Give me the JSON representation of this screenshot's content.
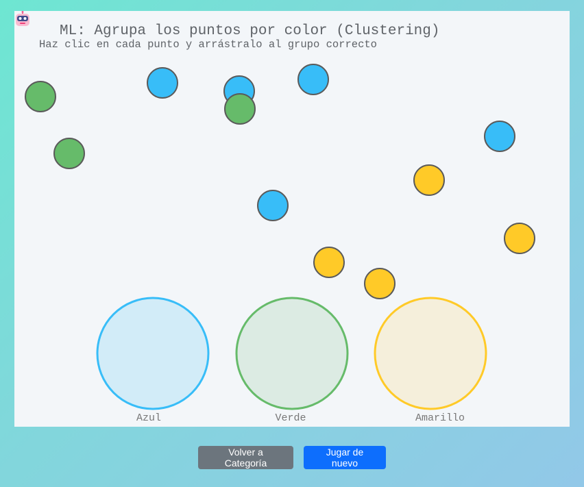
{
  "game": {
    "title": "ML: Agrupa los puntos por color (Clustering)",
    "subtitle": "Haz clic en cada punto y arrástralo al grupo correcto",
    "title_icon": "robot-icon"
  },
  "colors": {
    "blue": "#38bdf8",
    "green": "#66bb6a",
    "yellow": "#ffca28"
  },
  "groups": [
    {
      "id": "blue",
      "label": "Azul",
      "fill": "#d2ecf8",
      "stroke": "#38bdf8"
    },
    {
      "id": "green",
      "label": "Verde",
      "fill": "#dcebe3",
      "stroke": "#66bb6a"
    },
    {
      "id": "yellow",
      "label": "Amarillo",
      "fill": "#f5efdb",
      "stroke": "#ffca28"
    }
  ],
  "points": [
    {
      "color": "green"
    },
    {
      "color": "blue"
    },
    {
      "color": "blue"
    },
    {
      "color": "green"
    },
    {
      "color": "blue"
    },
    {
      "color": "green"
    },
    {
      "color": "blue"
    },
    {
      "color": "yellow"
    },
    {
      "color": "blue"
    },
    {
      "color": "yellow"
    },
    {
      "color": "yellow"
    },
    {
      "color": "yellow"
    }
  ],
  "buttons": {
    "back_label": "Volver a Categoría",
    "play_label": "Jugar de nuevo"
  }
}
